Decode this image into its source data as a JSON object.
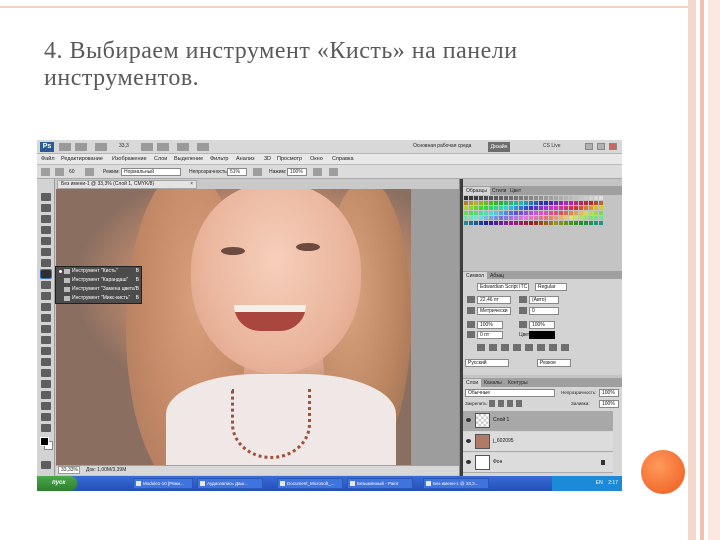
{
  "slide": {
    "title": "4. Выбираем инструмент «Кисть» на панели инструментов."
  },
  "photoshop": {
    "logo": "Ps",
    "zoom_top": "33,3",
    "workspace_label": "Основная рабочая среда",
    "design_button": "Дизайн",
    "cs_live": "CS Live",
    "menu": [
      "Файл",
      "Редактирование",
      "Изображение",
      "Слои",
      "Выделение",
      "Фильтр",
      "Анализ",
      "3D",
      "Просмотр",
      "Окно",
      "Справка"
    ],
    "options": {
      "brush_size": "60",
      "mode_label": "Режим:",
      "mode_value": "Нормальный",
      "opacity_label": "Непрозрачность:",
      "opacity_value": "51%",
      "flow_label": "Нажим:",
      "flow_value": "100%"
    },
    "document_tab": "Без имени-1 @ 33,3% (Слой 1, CMYK/8)",
    "status": {
      "zoom": "33,33%",
      "info": "Док: 1,00M/3,39M"
    },
    "flyout": [
      {
        "label": "Инструмент \"Кисть\"",
        "key": "B",
        "selected": true
      },
      {
        "label": "Инструмент \"Карандаш\"",
        "key": "B",
        "selected": false
      },
      {
        "label": "Инструмент \"Замена цвета\"",
        "key": "B",
        "selected": false
      },
      {
        "label": "Инструмент \"Микс-кисть\"",
        "key": "B",
        "selected": false
      }
    ],
    "panels": {
      "swatch_tabs": [
        "Образцы",
        "Стили",
        "Цвет"
      ],
      "char_tabs": [
        "Символ",
        "Абзац"
      ],
      "font_family": "Edwardian Script ITC",
      "font_style": "Regular",
      "font_size": "22,46 пт",
      "leading": "(Авто)",
      "kerning": "Метрически",
      "tracking": "0",
      "vscale": "100%",
      "hscale": "100%",
      "baseline": "0 пт",
      "color_label": "Цвет:",
      "language": "Русский",
      "antialias": "Резкое",
      "layer_tabs": [
        "Слои",
        "Каналы",
        "Контуры"
      ],
      "blend_mode": "Обычные",
      "opacity_label": "Непрозрачность:",
      "opacity_value": "100%",
      "lock_label": "Закрепить:",
      "fill_label": "Заливка:",
      "fill_value": "100%",
      "layers": [
        {
          "name": "Слой 1",
          "selected": true
        },
        {
          "name": "j_602095",
          "selected": false
        },
        {
          "name": "Фон",
          "selected": false
        }
      ]
    },
    "taskbar": {
      "start": "пуск",
      "tasks": [
        "Module1-10 [Режи...",
        "Аудиозапись Даш...",
        "Document_Microsoft_...",
        "Безымянный - Paint",
        "Без имени-1 @ 33,3..."
      ],
      "lang": "EN",
      "time": "2:17"
    }
  }
}
